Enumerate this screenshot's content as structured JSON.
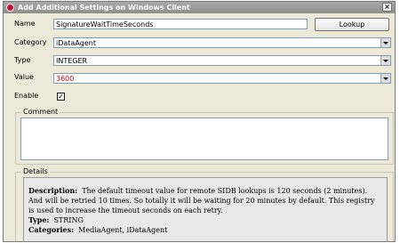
{
  "window": {
    "title": "Add Additional Settings on Windows Client",
    "close_glyph": "×"
  },
  "form": {
    "name_label": "Name",
    "name_value": "SignatureWaitTimeSeconds",
    "lookup_label": "Lookup",
    "category_label": "Category",
    "category_value": "iDataAgent",
    "type_label": "Type",
    "type_value": "INTEGER",
    "value_label": "Value",
    "value_value": "3600",
    "value_color": "#d00000",
    "enable_label": "Enable",
    "enable_checked": true,
    "enable_glyph": "✓"
  },
  "comment": {
    "legend": "Comment",
    "text": ""
  },
  "details": {
    "legend": "Details",
    "description_label": "Description:",
    "description_text": "The default timeout value for remote SIDB lookups is 120 seconds (2 minutes). And will be retried 10 times. So totally it will be waiting for 20 minutes by default. This registry is used to increase the timeout seconds on each retry.",
    "type_label": "Type:",
    "type_text": "STRING",
    "categories_label": "Categories:",
    "categories_text": "MediaAgent, iDataAgent"
  }
}
